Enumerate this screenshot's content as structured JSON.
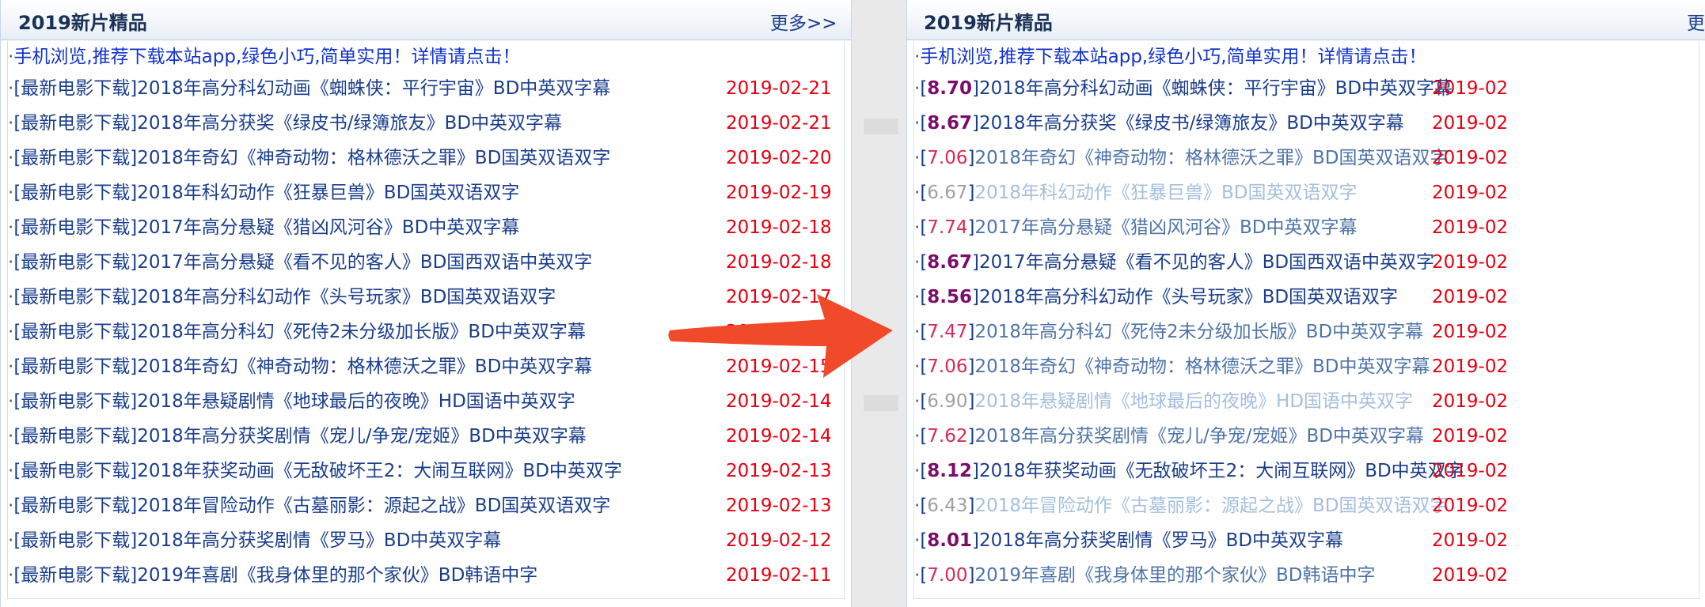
{
  "left_panel": {
    "title": "2019新片精品",
    "more": "更多>>",
    "notice": "手机浏览,推荐下载本站app,绿色小巧,简单实用！详情请点击！",
    "rows": [
      {
        "tag": "[最新电影下载]",
        "title": "2018年高分科幻动画《蜘蛛侠：平行宇宙》BD中英双字幕",
        "date": "2019-02-21"
      },
      {
        "tag": "[最新电影下载]",
        "title": "2018年高分获奖《绿皮书/绿簿旅友》BD中英双字幕",
        "date": "2019-02-21"
      },
      {
        "tag": "[最新电影下载]",
        "title": "2018年奇幻《神奇动物：格林德沃之罪》BD国英双语双字",
        "date": "2019-02-20"
      },
      {
        "tag": "[最新电影下载]",
        "title": "2018年科幻动作《狂暴巨兽》BD国英双语双字",
        "date": "2019-02-19"
      },
      {
        "tag": "[最新电影下载]",
        "title": "2017年高分悬疑《猎凶风河谷》BD中英双字幕",
        "date": "2019-02-18"
      },
      {
        "tag": "[最新电影下载]",
        "title": "2017年高分悬疑《看不见的客人》BD国西双语中英双字",
        "date": "2019-02-18"
      },
      {
        "tag": "[最新电影下载]",
        "title": "2018年高分科幻动作《头号玩家》BD国英双语双字",
        "date": "2019-02-17"
      },
      {
        "tag": "[最新电影下载]",
        "title": "2018年高分科幻《死侍2未分级加长版》BD中英双字幕",
        "date": "2019-02-16"
      },
      {
        "tag": "[最新电影下载]",
        "title": "2018年奇幻《神奇动物：格林德沃之罪》BD中英双字幕",
        "date": "2019-02-15"
      },
      {
        "tag": "[最新电影下载]",
        "title": "2018年悬疑剧情《地球最后的夜晚》HD国语中英双字",
        "date": "2019-02-14"
      },
      {
        "tag": "[最新电影下载]",
        "title": "2018年高分获奖剧情《宠儿/争宠/宠姬》BD中英双字幕",
        "date": "2019-02-14"
      },
      {
        "tag": "[最新电影下载]",
        "title": "2018年获奖动画《无敌破坏王2：大闹互联网》BD中英双字",
        "date": "2019-02-13"
      },
      {
        "tag": "[最新电影下载]",
        "title": "2018年冒险动作《古墓丽影：源起之战》BD国英双语双字",
        "date": "2019-02-13"
      },
      {
        "tag": "[最新电影下载]",
        "title": "2018年高分获奖剧情《罗马》BD中英双字幕",
        "date": "2019-02-12"
      },
      {
        "tag": "[最新电影下载]",
        "title": "2019年喜剧《我身体里的那个家伙》BD韩语中字",
        "date": "2019-02-11"
      }
    ]
  },
  "right_panel": {
    "title": "2019新片精品",
    "more": "更",
    "notice": "手机浏览,推荐下载本站app,绿色小巧,简单实用！详情请点击！",
    "rows": [
      {
        "rating": "8.70",
        "level": "hi",
        "title": "2018年高分科幻动画《蜘蛛侠：平行宇宙》BD中英双字幕",
        "date": "2019-02"
      },
      {
        "rating": "8.67",
        "level": "hi",
        "title": "2018年高分获奖《绿皮书/绿簿旅友》BD中英双字幕",
        "date": "2019-02"
      },
      {
        "rating": "7.06",
        "level": "mid",
        "title": "2018年奇幻《神奇动物：格林德沃之罪》BD国英双语双字",
        "date": "2019-02"
      },
      {
        "rating": "6.67",
        "level": "lo",
        "title": "2018年科幻动作《狂暴巨兽》BD国英双语双字",
        "date": "2019-02"
      },
      {
        "rating": "7.74",
        "level": "mid",
        "title": "2017年高分悬疑《猎凶风河谷》BD中英双字幕",
        "date": "2019-02"
      },
      {
        "rating": "8.67",
        "level": "hi",
        "title": "2017年高分悬疑《看不见的客人》BD国西双语中英双字",
        "date": "2019-02"
      },
      {
        "rating": "8.56",
        "level": "hi",
        "title": "2018年高分科幻动作《头号玩家》BD国英双语双字",
        "date": "2019-02"
      },
      {
        "rating": "7.47",
        "level": "mid",
        "title": "2018年高分科幻《死侍2未分级加长版》BD中英双字幕",
        "date": "2019-02"
      },
      {
        "rating": "7.06",
        "level": "mid",
        "title": "2018年奇幻《神奇动物：格林德沃之罪》BD中英双字幕",
        "date": "2019-02"
      },
      {
        "rating": "6.90",
        "level": "lo",
        "title": "2018年悬疑剧情《地球最后的夜晚》HD国语中英双字",
        "date": "2019-02"
      },
      {
        "rating": "7.62",
        "level": "mid",
        "title": "2018年高分获奖剧情《宠儿/争宠/宠姬》BD中英双字幕",
        "date": "2019-02"
      },
      {
        "rating": "8.12",
        "level": "hi",
        "title": "2018年获奖动画《无敌破坏王2：大闹互联网》BD中英双字",
        "date": "2019-02"
      },
      {
        "rating": "6.43",
        "level": "lo",
        "title": "2018年冒险动作《古墓丽影：源起之战》BD国英双语双字",
        "date": "2019-02"
      },
      {
        "rating": "8.01",
        "level": "hi",
        "title": "2018年高分获奖剧情《罗马》BD中英双字幕",
        "date": "2019-02"
      },
      {
        "rating": "7.00",
        "level": "mid",
        "title": "2019年喜剧《我身体里的那个家伙》BD韩语中字",
        "date": "2019-02"
      }
    ]
  },
  "colors": {
    "date": "#e60012",
    "title": "#1a3e8c",
    "rating_high": "#7b0c6a",
    "rating_mid": "#d82a55",
    "rating_low": "#a0a0a0",
    "arrow": "#f04a2a"
  },
  "arrow_icon": "right-arrow-icon"
}
